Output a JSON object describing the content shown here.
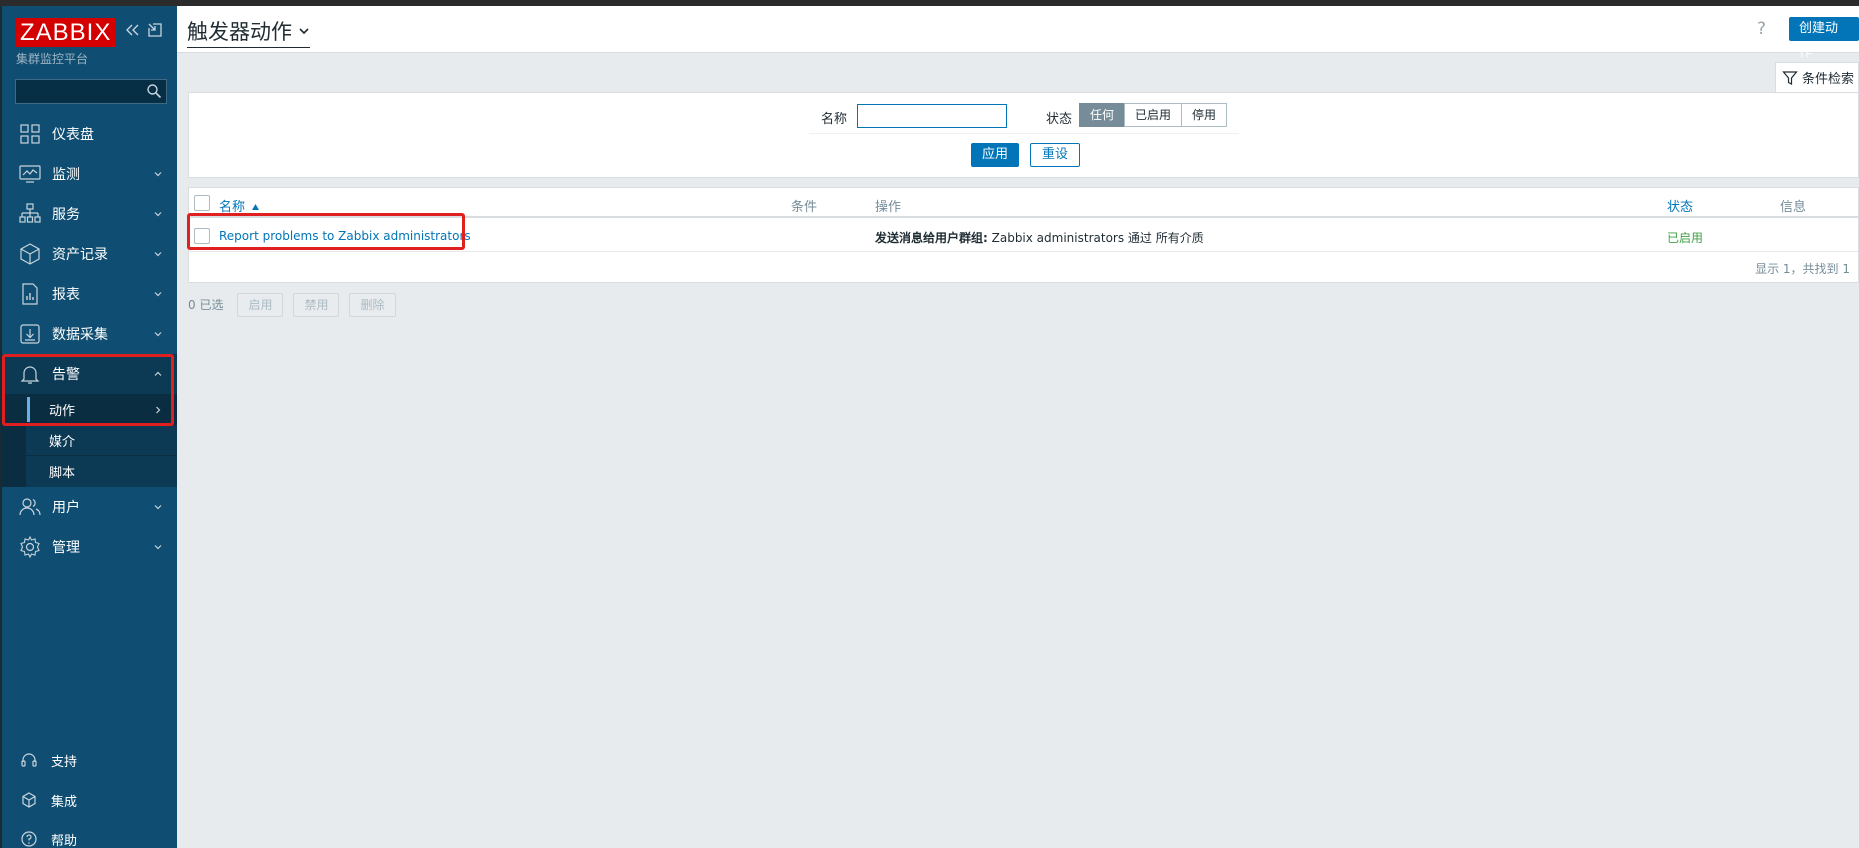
{
  "sidebar": {
    "logo": "ZABBIX",
    "subtitle": "集群监控平台",
    "search_placeholder": "",
    "nav": [
      {
        "label": "仪表盘",
        "icon": "dashboard-icon",
        "chevron": false
      },
      {
        "label": "监测",
        "icon": "monitoring-icon",
        "chevron": true
      },
      {
        "label": "服务",
        "icon": "services-icon",
        "chevron": true
      },
      {
        "label": "资产记录",
        "icon": "inventory-icon",
        "chevron": true
      },
      {
        "label": "报表",
        "icon": "reports-icon",
        "chevron": true
      },
      {
        "label": "数据采集",
        "icon": "data-collection-icon",
        "chevron": true
      },
      {
        "label": "告警",
        "icon": "bell-icon",
        "chevron": true,
        "expanded": true
      },
      {
        "label": "用户",
        "icon": "users-icon",
        "chevron": true
      },
      {
        "label": "管理",
        "icon": "gear-icon",
        "chevron": true
      }
    ],
    "alerts_sub": [
      {
        "label": "动作",
        "active": true
      },
      {
        "label": "媒介"
      },
      {
        "label": "脚本"
      }
    ],
    "footer": [
      {
        "label": "支持",
        "icon": "headset-icon"
      },
      {
        "label": "集成",
        "icon": "integrations-icon"
      },
      {
        "label": "帮助",
        "icon": "help-icon"
      }
    ]
  },
  "header": {
    "title": "触发器动作",
    "help": "?",
    "create_button": "创建动作"
  },
  "filter": {
    "tab_label": "条件检索",
    "name_label": "名称",
    "name_value": "",
    "status_label": "状态",
    "status_options": [
      "任何",
      "已启用",
      "停用"
    ],
    "status_selected": "任何",
    "apply": "应用",
    "reset": "重设"
  },
  "table": {
    "columns": {
      "name": "名称",
      "conditions": "条件",
      "operations": "操作",
      "status": "状态",
      "info": "信息"
    },
    "rows": [
      {
        "name": "Report problems to Zabbix administrators",
        "conditions": "",
        "op_bold": "发送消息给用户群组:",
        "op_rest": " Zabbix administrators 通过 所有介质",
        "status": "已启用",
        "info": ""
      }
    ],
    "footer": "显示 1，共找到 1"
  },
  "actions": {
    "selected": "0 已选",
    "enable": "启用",
    "disable": "禁用",
    "delete": "删除"
  },
  "colors": {
    "sidebar_bg": "#0f4e72",
    "brand_red": "#d40000",
    "accent_blue": "#0275b8",
    "status_green": "#429e47",
    "highlight_red": "#e02020"
  }
}
